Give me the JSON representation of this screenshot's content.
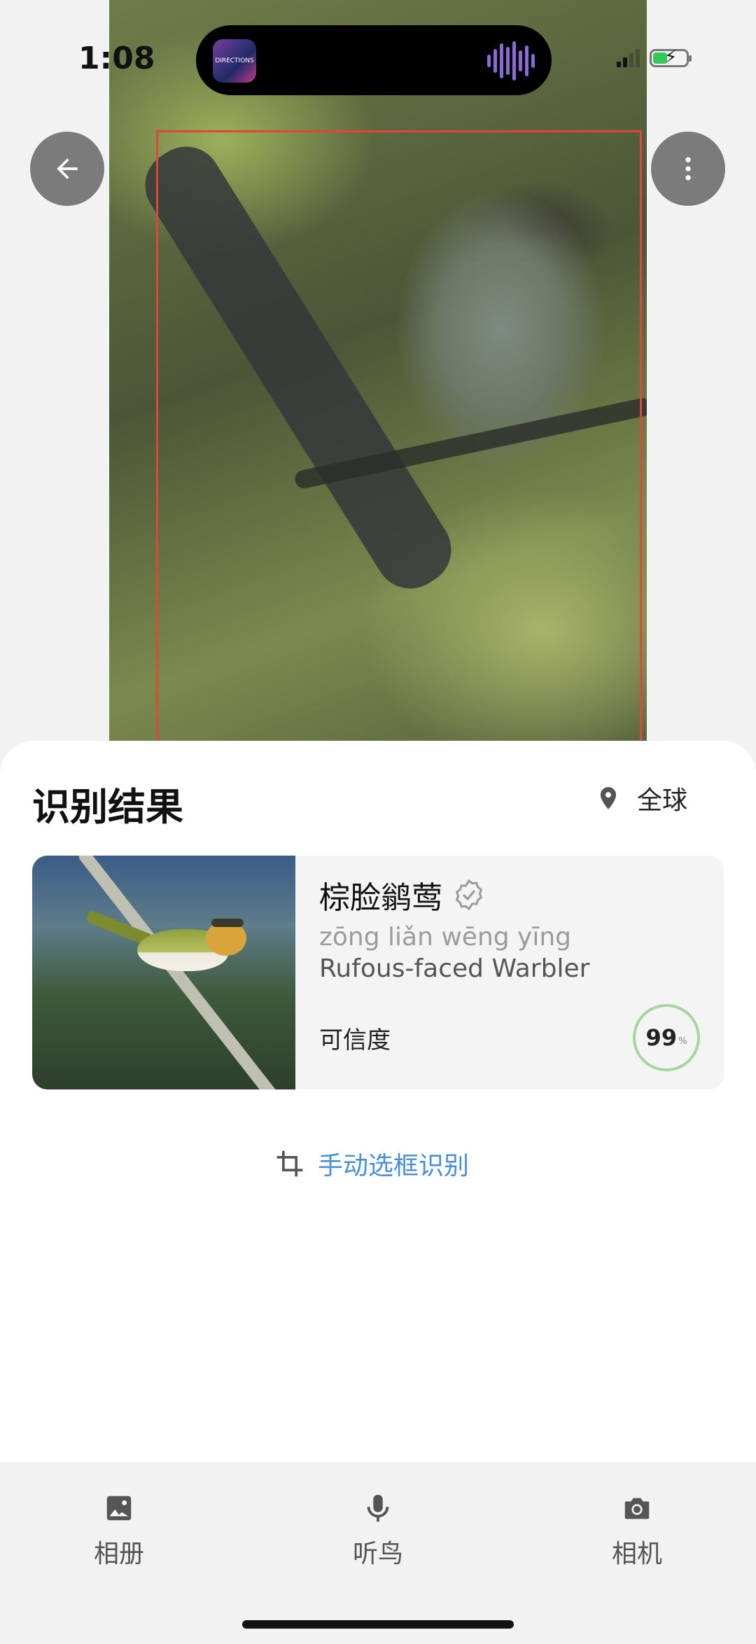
{
  "status_bar": {
    "time": "1:08",
    "island_app_text": "DIRECTIONS"
  },
  "top_buttons": {
    "back_icon": "arrow-left-icon",
    "more_icon": "more-vertical-icon"
  },
  "result": {
    "title": "识别结果",
    "region_icon": "location-pin-icon",
    "region": "全球",
    "card": {
      "name": "棕脸鹟莺",
      "verified_icon": "badge-check-icon",
      "pinyin": "zōng liǎn wēng yīng",
      "scientific_name": "Rufous-faced Warbler",
      "confidence_label": "可信度",
      "confidence_value": "99",
      "confidence_unit": "%"
    },
    "manual_crop_icon": "crop-icon",
    "manual_crop_label": "手动选框识别"
  },
  "bottom_nav": {
    "items": [
      {
        "label": "相册",
        "icon": "gallery-icon"
      },
      {
        "label": "听鸟",
        "icon": "microphone-icon"
      },
      {
        "label": "相机",
        "icon": "camera-icon"
      }
    ]
  },
  "colors": {
    "detect_box": "#e0463a",
    "link_blue": "#4a8fd6",
    "confidence_ring": "#a6d6a0"
  }
}
